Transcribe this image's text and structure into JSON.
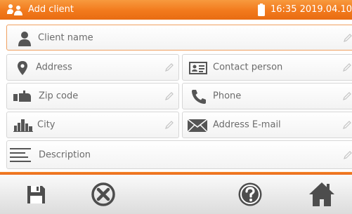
{
  "header": {
    "title": "Add client",
    "clock": "16:35 2019.04.10"
  },
  "form": {
    "client_name": "Client name",
    "address": "Address",
    "contact_person": "Contact person",
    "zip_code": "Zip code",
    "phone": "Phone",
    "city": "City",
    "email": "Address E-mail",
    "description": "Description"
  },
  "icons": {
    "app": "users-icon",
    "battery": "battery-icon",
    "client": "person-icon",
    "address": "location-pin-icon",
    "contact": "contact-card-icon",
    "zip": "mailbox-icon",
    "phone": "phone-icon",
    "city": "city-icon",
    "email": "envelope-icon",
    "description": "text-lines-icon",
    "edit": "pencil-icon",
    "save": "save-icon",
    "cancel": "cancel-icon",
    "help": "help-icon",
    "home": "home-icon"
  },
  "colors": {
    "accent": "#f2791c",
    "field_border": "#d6d6d6",
    "icon": "#555555",
    "text": "#6b6b6b"
  }
}
